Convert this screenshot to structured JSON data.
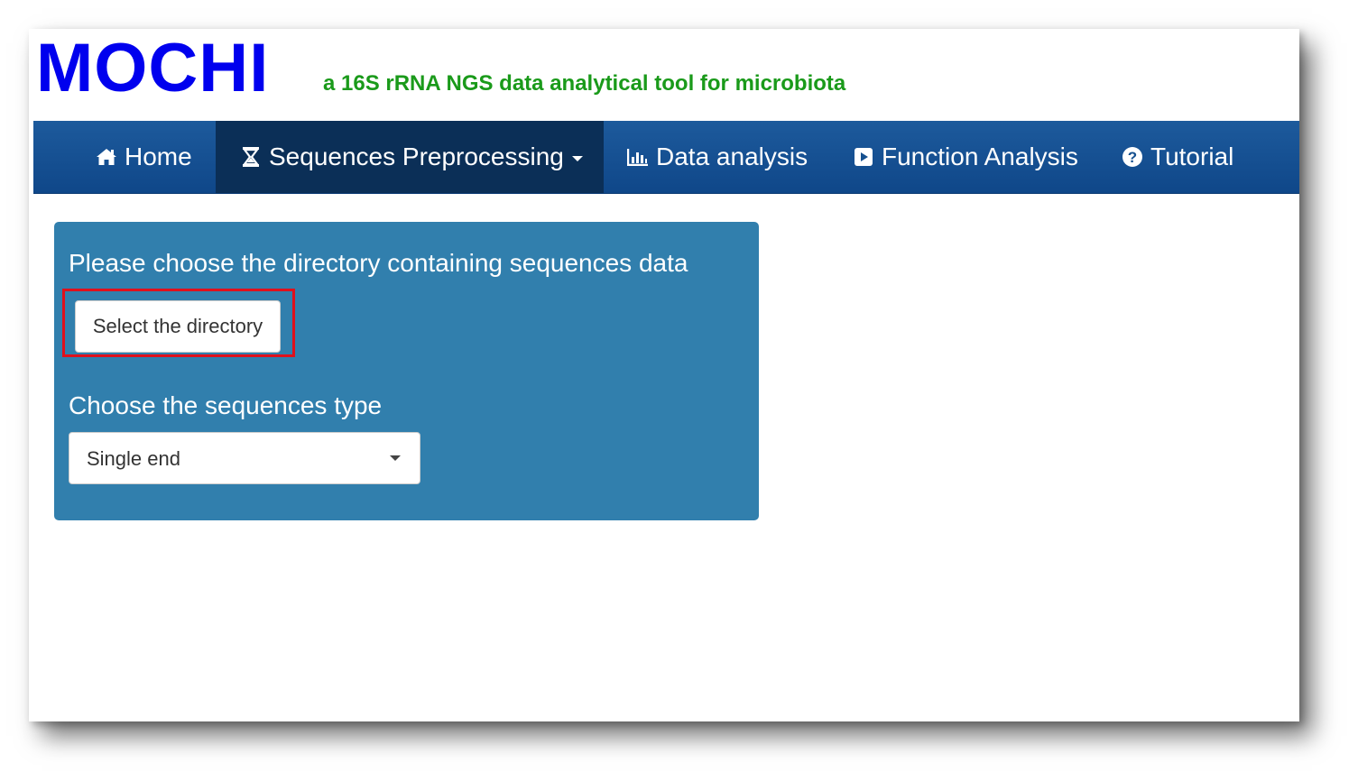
{
  "header": {
    "logo_text": "MOCHI",
    "tagline": "a 16S rRNA NGS data analytical tool for microbiota"
  },
  "navbar": {
    "items": [
      {
        "label": "Home",
        "icon": "home-icon",
        "active": false
      },
      {
        "label": "Sequences Preprocessing",
        "icon": "hourglass-icon",
        "active": true,
        "has_dropdown": true
      },
      {
        "label": "Data analysis",
        "icon": "bar-chart-icon",
        "active": false
      },
      {
        "label": "Function Analysis",
        "icon": "play-icon",
        "active": false
      },
      {
        "label": "Tutorial",
        "icon": "question-circle-icon",
        "active": false
      }
    ]
  },
  "panel": {
    "directory_label": "Please choose the directory containing sequences data",
    "directory_button": "Select the directory",
    "type_label": "Choose the sequences type",
    "type_select_value": "Single end"
  },
  "colors": {
    "logo": "#0000ee",
    "tagline": "#1a9a1a",
    "navbar": "#15508f",
    "navbar_active": "#0b2f57",
    "panel": "#317fad",
    "highlight": "#e0101c"
  }
}
